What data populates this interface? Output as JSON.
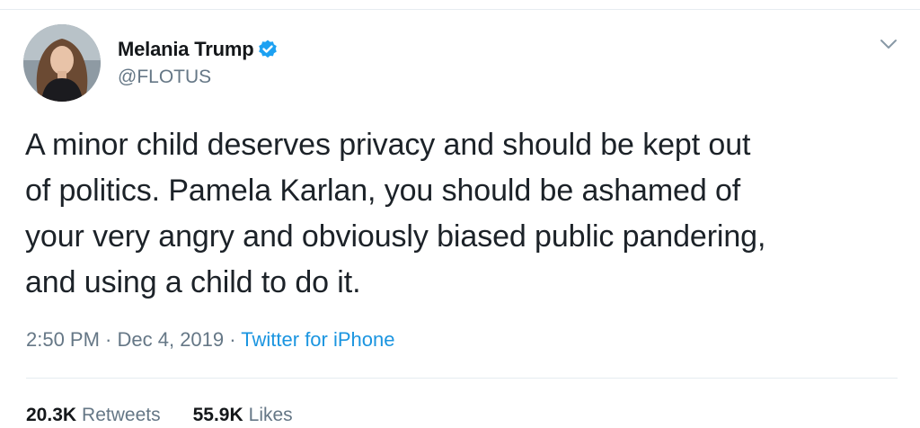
{
  "author": {
    "display_name": "Melania Trump",
    "handle": "@FLOTUS",
    "verified_icon": "verified-badge-icon",
    "avatar": "profile-photo"
  },
  "menu_icon": "chevron-down-icon",
  "tweet": {
    "lines": [
      "A minor child deserves privacy and should be kept out",
      "of politics. Pamela Karlan, you should be ashamed of",
      "your very angry and obviously biased public pandering,",
      "and using a child to do it."
    ]
  },
  "meta": {
    "time": "2:50 PM",
    "sep1": " · ",
    "date": "Dec 4, 2019",
    "sep2": " · ",
    "source": "Twitter for iPhone"
  },
  "stats": {
    "retweets_count": "20.3K",
    "retweets_label": "Retweets",
    "likes_count": "55.9K",
    "likes_label": "Likes"
  },
  "colors": {
    "link": "#1b95e0",
    "secondary_text": "#657786",
    "verified": "#1da1f2"
  }
}
